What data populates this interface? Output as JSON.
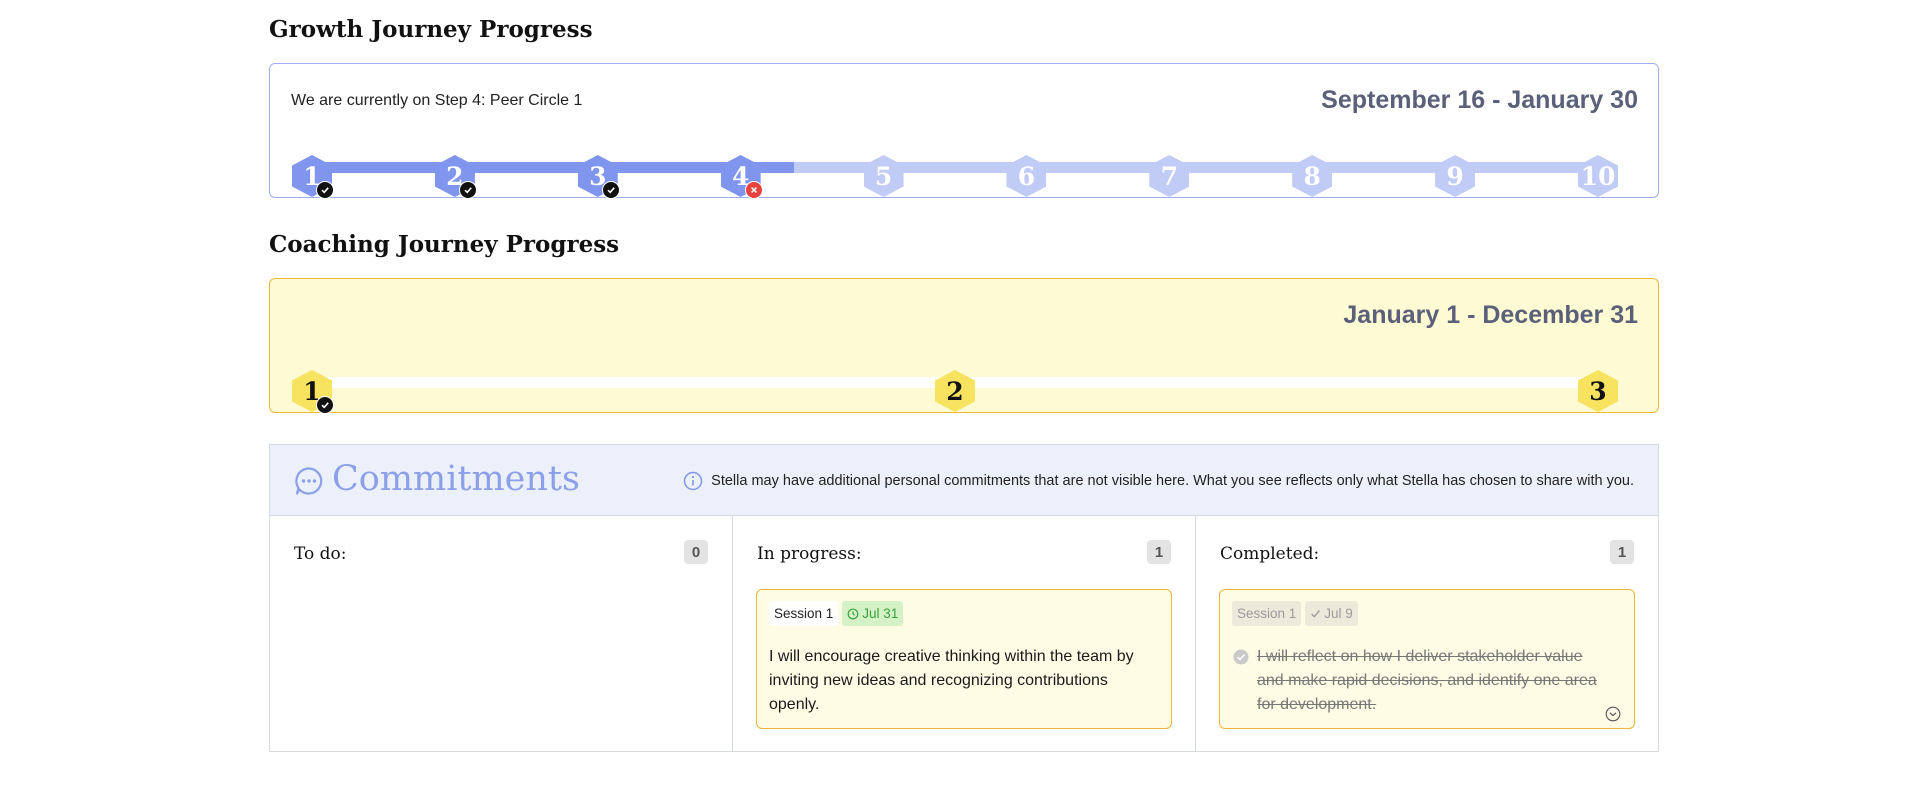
{
  "growth": {
    "title": "Growth Journey Progress",
    "current_step": "We are currently on Step 4: Peer Circle 1",
    "date_range": "September 16 - January 30",
    "steps": [
      {
        "label": "1",
        "status": "done"
      },
      {
        "label": "2",
        "status": "done"
      },
      {
        "label": "3",
        "status": "done"
      },
      {
        "label": "4",
        "status": "missed"
      },
      {
        "label": "5",
        "status": "upcoming"
      },
      {
        "label": "6",
        "status": "upcoming"
      },
      {
        "label": "7",
        "status": "upcoming"
      },
      {
        "label": "8",
        "status": "upcoming"
      },
      {
        "label": "9",
        "status": "upcoming"
      },
      {
        "label": "10",
        "status": "upcoming"
      }
    ],
    "colors": {
      "active": "#7f95ee",
      "upcoming": "#c0cbf6",
      "border": "#9fb0ee"
    }
  },
  "coaching": {
    "title": "Coaching Journey Progress",
    "date_range": "January 1 - December 31",
    "steps": [
      {
        "label": "1",
        "status": "done"
      },
      {
        "label": "2",
        "status": "upcoming"
      },
      {
        "label": "3",
        "status": "upcoming"
      }
    ],
    "colors": {
      "hex": "#f7e35f",
      "track": "#ffffff",
      "background": "#fefad4"
    }
  },
  "commitments": {
    "title": "Commitments",
    "icon": "chat-bubble-icon",
    "note": "Stella may have additional personal commitments that are not visible here. What you see reflects only what Stella has chosen to share with you.",
    "columns": {
      "todo": {
        "label": "To do:",
        "count": "0"
      },
      "in_progress": {
        "label": "In progress:",
        "count": "1",
        "card": {
          "session": "Session 1",
          "due": "Jul 31",
          "text": "I will encourage creative thinking within the team by inviting new ideas and recognizing contributions openly."
        }
      },
      "completed": {
        "label": "Completed:",
        "count": "1",
        "card": {
          "session": "Session 1",
          "done_date": "Jul 9",
          "text": "I will reflect on how I deliver stakeholder value and make rapid decisions, and identify one area for development."
        }
      }
    }
  }
}
